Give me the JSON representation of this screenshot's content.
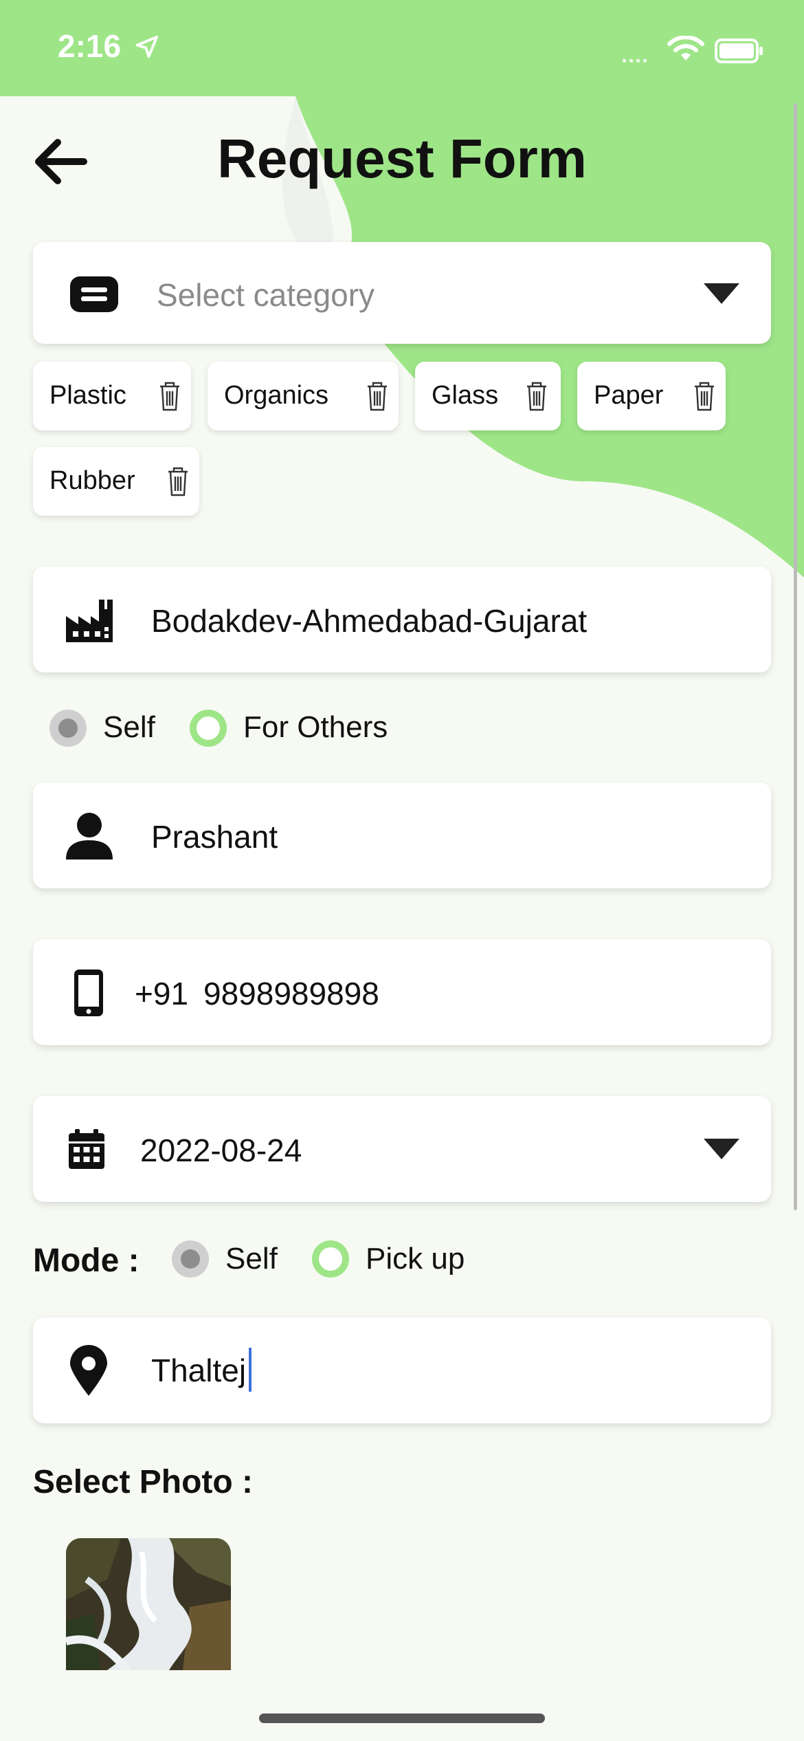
{
  "status_bar": {
    "time": "2:16"
  },
  "header": {
    "title": "Request Form"
  },
  "category": {
    "placeholder": "Select category"
  },
  "selected_categories": [
    "Plastic",
    "Organics",
    "Glass",
    "Paper",
    "Rubber"
  ],
  "location": {
    "value": "Bodakdev-Ahmedabad-Gujarat"
  },
  "request_for": {
    "option_self": "Self",
    "option_others": "For Others"
  },
  "name": {
    "value": "Prashant"
  },
  "phone": {
    "country_code": "+91",
    "number": "9898989898"
  },
  "date": {
    "value": "2022-08-24"
  },
  "mode": {
    "label": "Mode :",
    "option_self": "Self",
    "option_pickup": "Pick up"
  },
  "address": {
    "value": "Thaltej"
  },
  "photo": {
    "label": "Select Photo :"
  },
  "colors": {
    "accent": "#9ee588",
    "background": "#f6faf2"
  }
}
